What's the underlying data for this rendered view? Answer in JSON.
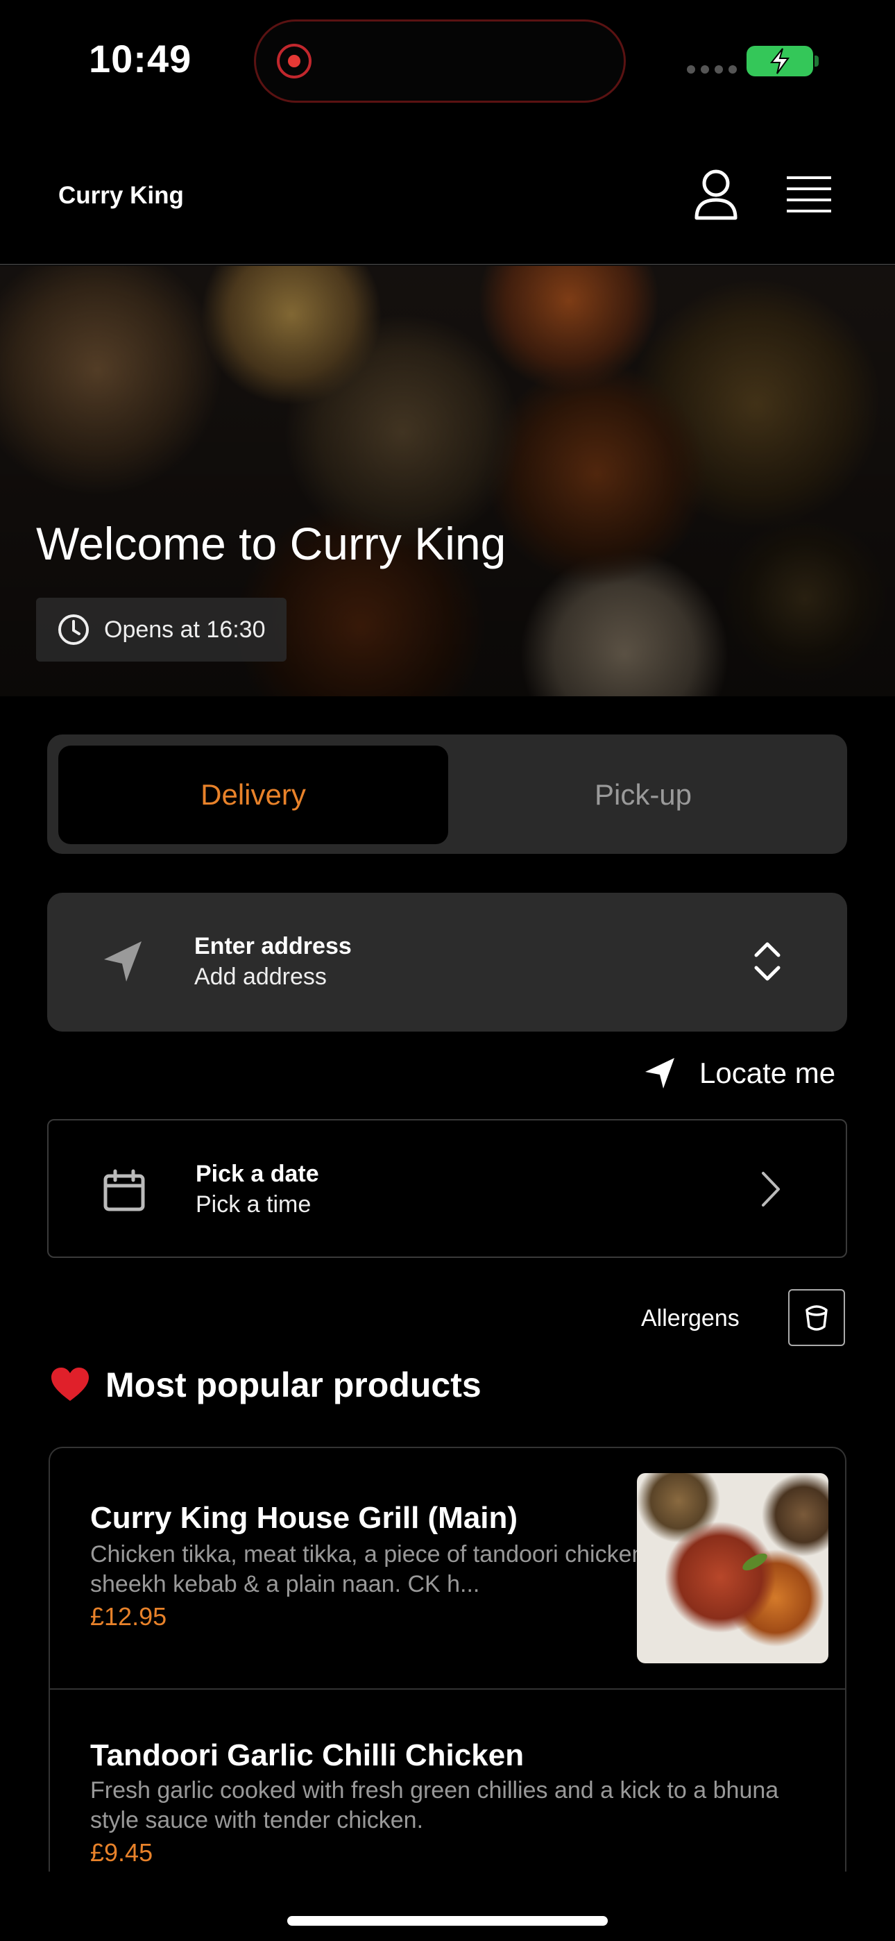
{
  "status_bar": {
    "time": "10:49"
  },
  "header": {
    "brand": "Curry King"
  },
  "hero": {
    "title": "Welcome to Curry King",
    "hours": "Opens at 16:30"
  },
  "mode_toggle": {
    "delivery": "Delivery",
    "pickup": "Pick-up",
    "selected": "Delivery"
  },
  "address": {
    "label": "Enter address",
    "value": "Add address"
  },
  "locate": {
    "label": "Locate me"
  },
  "date": {
    "label": "Pick a date",
    "value": "Pick a time"
  },
  "allergens": {
    "label": "Allergens"
  },
  "popular": {
    "title": "Most popular products",
    "items": [
      {
        "name": "Curry King House Grill (Main)",
        "description": "Chicken tikka, meat tikka, a piece of tandoori chicken, sheekh kebab & a plain naan. CK h...",
        "price": "£12.95"
      },
      {
        "name": "Tandoori Garlic Chilli Chicken",
        "description": "Fresh garlic cooked with fresh green chillies and a kick to a bhuna style sauce with tender chicken.",
        "price": "£9.45"
      }
    ]
  },
  "colors": {
    "accent": "#e8822a",
    "background": "#000000",
    "card": "#2c2c2c"
  }
}
